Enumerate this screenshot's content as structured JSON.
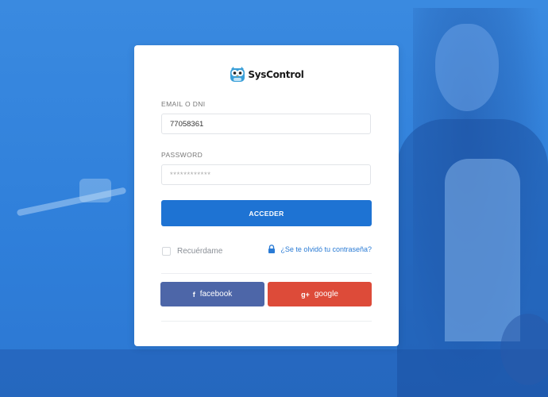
{
  "brand": {
    "name": "SysControl"
  },
  "form": {
    "email_label": "EMAIL O DNI",
    "email_value": "77058361",
    "password_label": "PASSWORD",
    "password_value": "************",
    "submit_label": "ACCEDER",
    "remember_label": "Recuérdame",
    "forgot_label": "¿Se te olvidó tu contraseña?"
  },
  "social": {
    "facebook_label": "facebook",
    "facebook_icon": "f",
    "google_label": "google",
    "google_icon": "g+"
  },
  "colors": {
    "background": "#2f7fda",
    "primary": "#1e73d3",
    "facebook": "#4d66a8",
    "google": "#dd4b39",
    "link": "#2a7bd5"
  },
  "icons": {
    "logo": "owl-icon",
    "forgot": "lock-icon",
    "facebook": "facebook-icon",
    "google": "google-plus-icon"
  }
}
